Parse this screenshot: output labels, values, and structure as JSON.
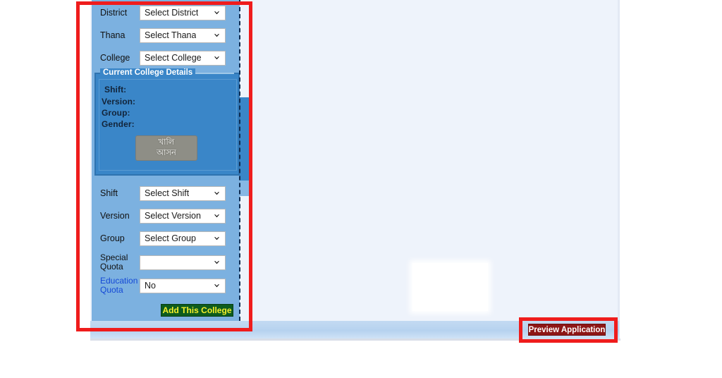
{
  "page": {
    "background": "#eef3fb",
    "panel_color": "#7cb1e0",
    "details_panel_color": "#3a86c8",
    "annotation_color": "#ef1c1c"
  },
  "form": {
    "rows": [
      {
        "label": "District",
        "value": "Select District",
        "type": "select"
      },
      {
        "label": "Thana",
        "value": "Select Thana",
        "type": "select"
      },
      {
        "label": "College",
        "value": "Select College",
        "type": "select"
      }
    ]
  },
  "current_college_details": {
    "legend": "Current College Details",
    "fields": [
      {
        "label": "Shift:"
      },
      {
        "label": "Version:"
      },
      {
        "label": "Group:"
      },
      {
        "label": "Gender:"
      }
    ],
    "seat_button": {
      "line1": "খালি",
      "line2": "আসন"
    }
  },
  "selection_form": {
    "rows": [
      {
        "label": "Shift",
        "value": "Select Shift",
        "link": false
      },
      {
        "label": "Version",
        "value": "Select Version",
        "link": false
      },
      {
        "label": "Group",
        "value": "Select Group",
        "link": false
      }
    ],
    "special_quota": {
      "label_line1": "Special",
      "label_line2": "Quota",
      "value": ""
    },
    "education_quota": {
      "label_line1": "Education",
      "label_line2": "Quota",
      "value": "No"
    },
    "add_button": "Add This College"
  },
  "footer": {
    "preview_button": "Preview Application"
  },
  "icons": {
    "chevron_down": "chevron-down-icon"
  }
}
